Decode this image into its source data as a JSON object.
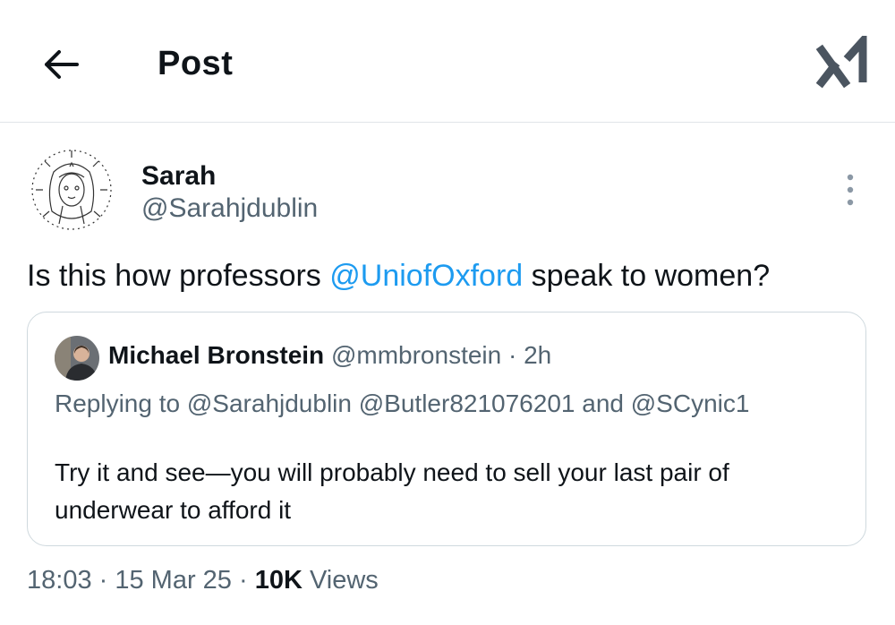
{
  "header": {
    "title": "Post"
  },
  "post": {
    "author_name": "Sarah",
    "author_handle": "@Sarahjdublin",
    "text_before": "Is this how professors ",
    "mention": "@UniofOxford",
    "text_after": " speak to women?"
  },
  "quote": {
    "author_name": "Michael Bronstein",
    "author_handle": "@mmbronstein",
    "separator": " · ",
    "age": "2h",
    "replying_prefix": "Replying to ",
    "replying_to": [
      "@Sarahjdublin",
      "@Butler821076201"
    ],
    "replying_and": " and ",
    "replying_last": "@SCynic1",
    "text": "Try it and see—you will probably need to sell your last pair of underwear to afford it"
  },
  "footer": {
    "time": "18:03",
    "sep1": " · ",
    "date": "15 Mar 25",
    "sep2": " · ",
    "views_count": "10K",
    "views_label": " Views"
  },
  "colors": {
    "accent": "#1d9bf0",
    "secondary_text": "#536471",
    "border": "#cfd9de"
  },
  "icons": {
    "back": "back-arrow-icon",
    "grok": "grok-icon",
    "more": "more-vertical-icon"
  }
}
